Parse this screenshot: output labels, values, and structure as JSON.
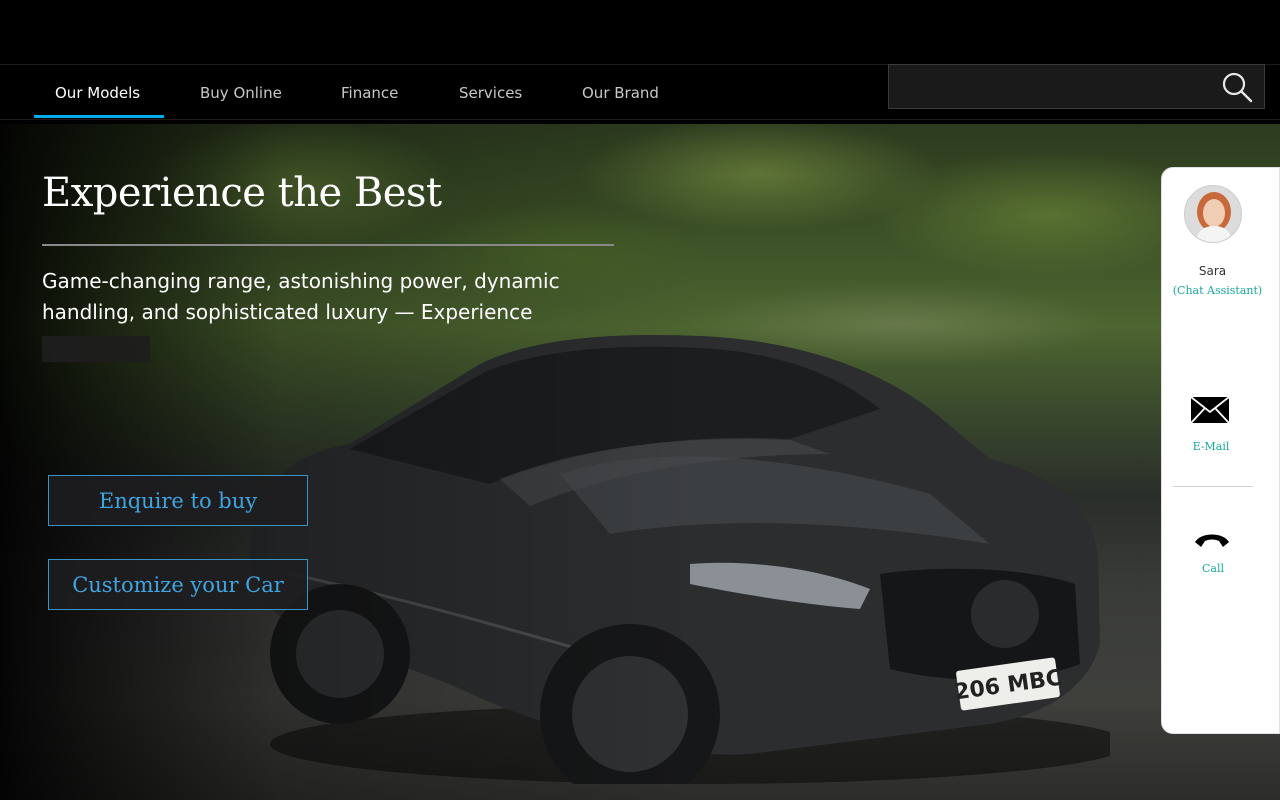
{
  "nav": {
    "items": [
      {
        "label": "Our Models",
        "active": true
      },
      {
        "label": "Buy Online",
        "active": false
      },
      {
        "label": "Finance",
        "active": false
      },
      {
        "label": "Services",
        "active": false
      },
      {
        "label": "Our Brand",
        "active": false
      }
    ],
    "search": {
      "value": "",
      "placeholder": "",
      "icon": "search-icon"
    }
  },
  "hero": {
    "title": "Experience the Best",
    "description": "Game-changing range, astonishing power, dynamic handling, and sophisticated luxury — Experience",
    "plate": "206 MBC",
    "buttons": {
      "enquire": "Enquire to buy",
      "customize": "Customize your Car"
    }
  },
  "assistant": {
    "name": "Sara",
    "role": "(Chat Assistant)",
    "email_label": "E-Mail",
    "call_label": "Call"
  },
  "colors": {
    "accent": "#00adef",
    "cta_text": "#3fa5e0",
    "panel_accent": "#18a89a"
  }
}
